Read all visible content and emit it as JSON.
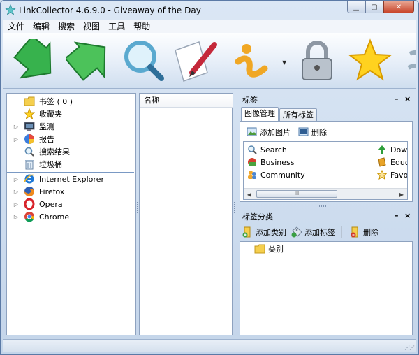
{
  "window": {
    "title": "LinkCollector 4.6.9.0 - Giveaway of the Day"
  },
  "menu": [
    "文件",
    "编辑",
    "搜索",
    "视图",
    "工具",
    "帮助"
  ],
  "toolbar": {
    "buttons": [
      {
        "name": "green-down-arrow-icon"
      },
      {
        "name": "green-up-arrow-icon"
      },
      {
        "name": "magnifier-icon"
      },
      {
        "name": "paper-pencil-icon"
      },
      {
        "name": "info-icon"
      },
      {
        "name": "padlock-icon"
      },
      {
        "name": "star-icon"
      }
    ]
  },
  "tree": {
    "items": [
      {
        "label": "书签 ( 0 )",
        "icon": "folder-icon"
      },
      {
        "label": "收藏夹",
        "icon": "star-icon"
      },
      {
        "label": "监测",
        "icon": "monitor-icon"
      },
      {
        "label": "报告",
        "icon": "pie-chart-icon"
      },
      {
        "label": "搜索结果",
        "icon": "search-icon"
      },
      {
        "label": "垃圾桶",
        "icon": "trash-icon"
      },
      {
        "label": "Internet Explorer",
        "icon": "ie-icon"
      },
      {
        "label": "Firefox",
        "icon": "firefox-icon"
      },
      {
        "label": "Opera",
        "icon": "opera-icon"
      },
      {
        "label": "Chrome",
        "icon": "chrome-icon"
      }
    ]
  },
  "list": {
    "column_header": "名称"
  },
  "tags_panel": {
    "title": "标签",
    "min_label": "–",
    "close_label": "×",
    "tabs": [
      "图像管理",
      "所有标签"
    ],
    "add_image_label": "添加图片",
    "delete_label": "删除",
    "items": [
      {
        "label": "Search",
        "icon": "search-icon"
      },
      {
        "label": "Business",
        "icon": "business-icon"
      },
      {
        "label": "Community",
        "icon": "community-icon"
      },
      {
        "label": "Down",
        "icon": "download-icon"
      },
      {
        "label": "Educa",
        "icon": "education-icon"
      },
      {
        "label": "Favor",
        "icon": "favorite-icon"
      }
    ],
    "scroll_thumb_label": "III"
  },
  "categories_panel": {
    "title": "标签分类",
    "min_label": "–",
    "close_label": "×",
    "add_category_label": "添加类别",
    "add_tag_label": "添加标签",
    "delete_label": "删除",
    "tree_root_label": "类别"
  },
  "colors": {
    "accent": "#4a7ab5",
    "window_bg": "#c4d5ea"
  }
}
